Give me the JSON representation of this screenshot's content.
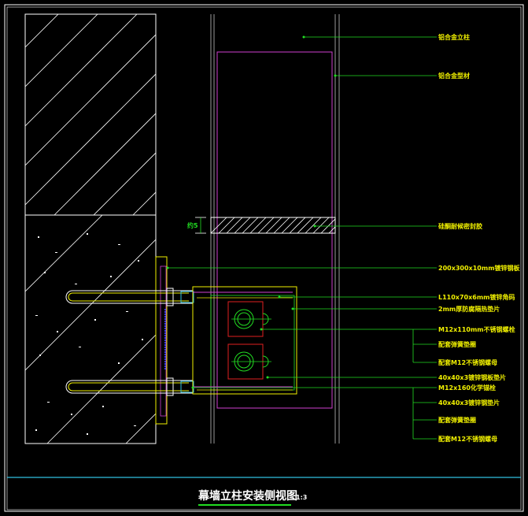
{
  "drawing": {
    "title": "幕墙立柱安装侧视图",
    "scale": "1:3",
    "dimension_text": "约5",
    "labels": [
      "铝合金立柱",
      "铝合金型材",
      "硅酮耐候密封胶",
      "200x300x10mm镀锌钢板",
      "L110x70x6mm镀锌角码",
      "2mm厚防腐隔热垫片",
      "M12x110mm不锈钢螺栓",
      "配套弹簧垫圈",
      "配套M12不锈钢螺母",
      "40x40x3镀锌钢板垫片",
      "M12x160化学锚栓",
      "40x40x3镀锌钢垫片",
      "配套弹簧垫圈",
      "配套M12不锈钢螺母"
    ]
  },
  "colors": {
    "background": "#000000",
    "frame": "#ffffff",
    "green": "#22dd22",
    "magenta": "#d040d0",
    "red": "#e02020",
    "yellow": "#f0f000",
    "cyan": "#30c0e0",
    "gray": "#9a9a9a",
    "blue": "#4040ff",
    "title_underline": "#22dd22"
  }
}
